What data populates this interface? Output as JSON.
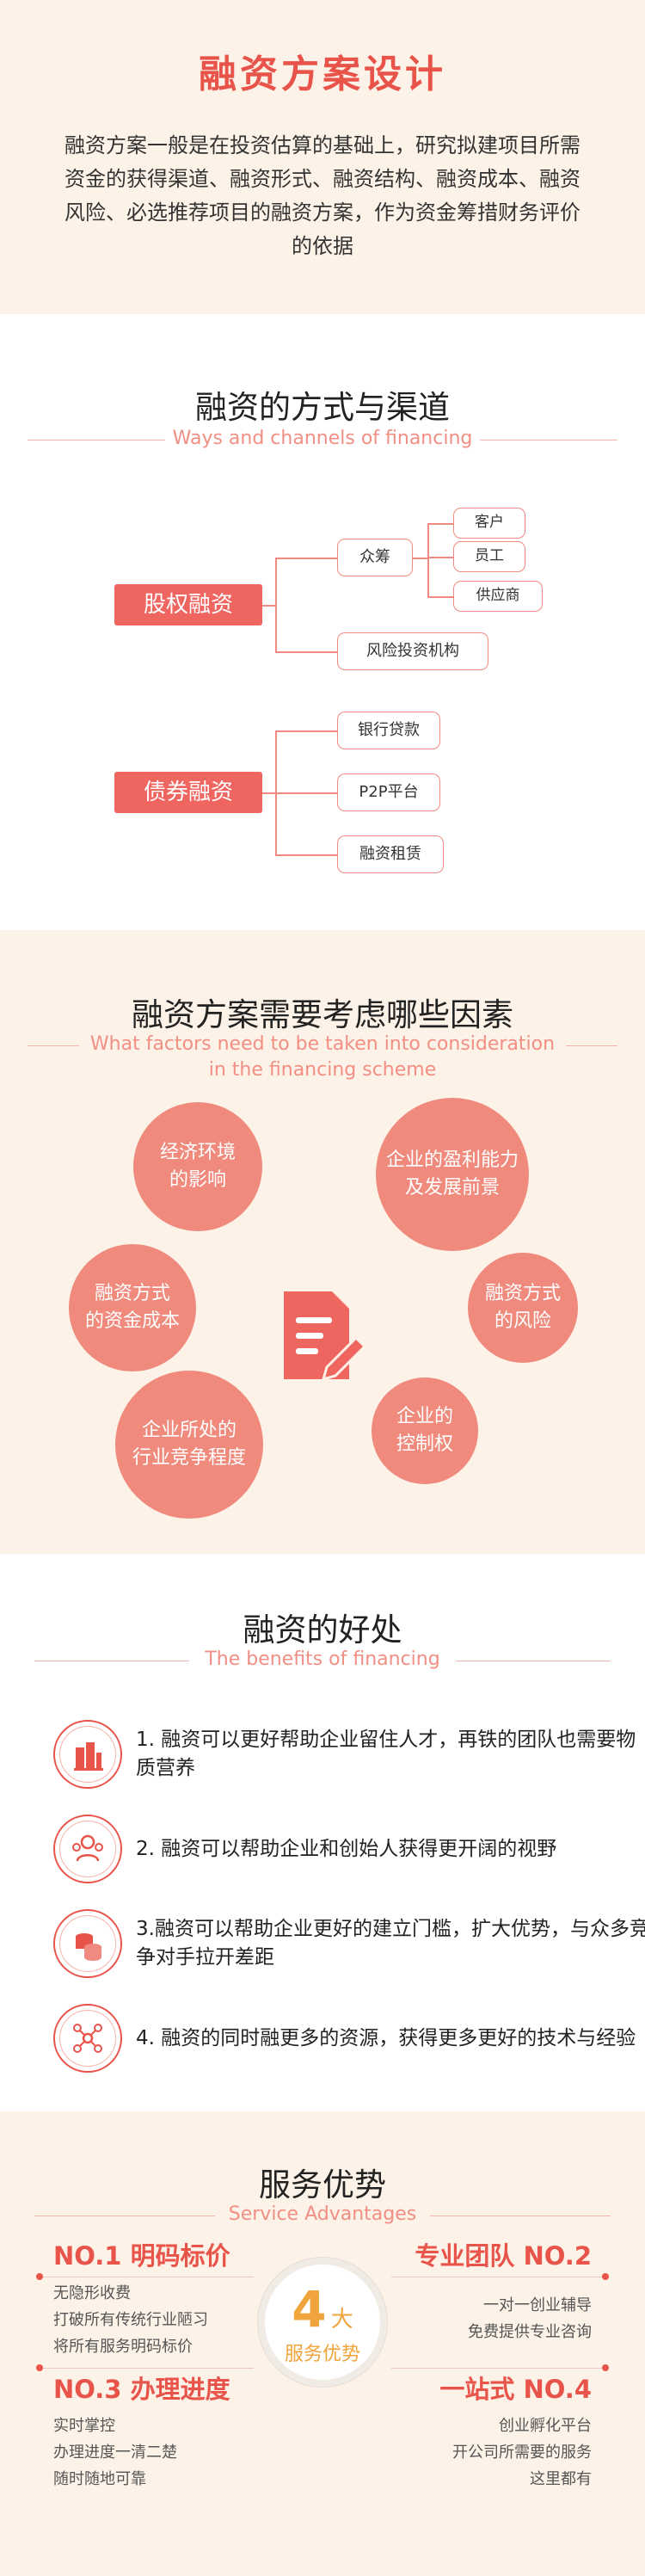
{
  "intro": {
    "title": "融资方案设计",
    "body": "融资方案一般是在投资估算的基础上，研究拟建项目所需资金的获得渠道、融资形式、融资结构、融资成本、融资风险、必选推荐项目的融资方案，作为资金筹措财务评价的依据"
  },
  "channels": {
    "title": "融资的方式与渠道",
    "subtitle": "Ways and channels of financing",
    "equity": "股权融资",
    "crowdfunding": "众筹",
    "customer": "客户",
    "employee": "员工",
    "supplier": "供应商",
    "vc": "风险投资机构",
    "debt": "债券融资",
    "bank": "银行贷款",
    "p2p": "P2P平台",
    "leasing": "融资租赁"
  },
  "factors": {
    "title": "融资方案需要考虑哪些因素",
    "subtitle_line1": "What factors need to be taken into consideration",
    "subtitle_line2": "in the financing scheme",
    "items": [
      "经济环境\n的影响",
      "企业的盈利能力\n及发展前景",
      "融资方式\n的资金成本",
      "融资方式\n的风险",
      "企业所处的\n行业竞争程度",
      "企业的\n控制权"
    ],
    "center_icon": "document-edit-icon"
  },
  "benefits": {
    "title": "融资的好处",
    "subtitle": "The benefits of financing",
    "items": [
      {
        "icon": "building-icon",
        "text": "1. 融资可以更好帮助企业留住人才，再铁的团队也需要物质营养"
      },
      {
        "icon": "team-icon",
        "text": "2. 融资可以帮助企业和创始人获得更开阔的视野"
      },
      {
        "icon": "coins-icon",
        "text": "3.融资可以帮助企业更好的建立门槛，扩大优势，与众多竞争对手拉开差距"
      },
      {
        "icon": "network-icon",
        "text": "4. 融资的同时融更多的资源，获得更多更好的技术与经验"
      }
    ]
  },
  "advantages": {
    "title": "服务优势",
    "subtitle": "Service Advantages",
    "center_number": "4",
    "center_unit": "大",
    "center_label": "服务优势",
    "items": [
      {
        "title": "NO.1 明码标价",
        "lines": [
          "无隐形收费",
          "打破所有传统行业陋习",
          "将所有服务明码标价"
        ]
      },
      {
        "title": "专业团队 NO.2",
        "lines": [
          "一对一创业辅导",
          "免费提供专业咨询"
        ]
      },
      {
        "title": "NO.3 办理进度",
        "lines": [
          "实时掌控",
          "办理进度一清二楚",
          "随时随地可靠"
        ]
      },
      {
        "title": "一站式 NO.4",
        "lines": [
          "创业孵化平台",
          "开公司所需要的服务",
          "这里都有"
        ]
      }
    ]
  },
  "colors": {
    "accent": "#e8534a",
    "soft": "#ef8a7d",
    "cream": "#fdf2e7"
  }
}
